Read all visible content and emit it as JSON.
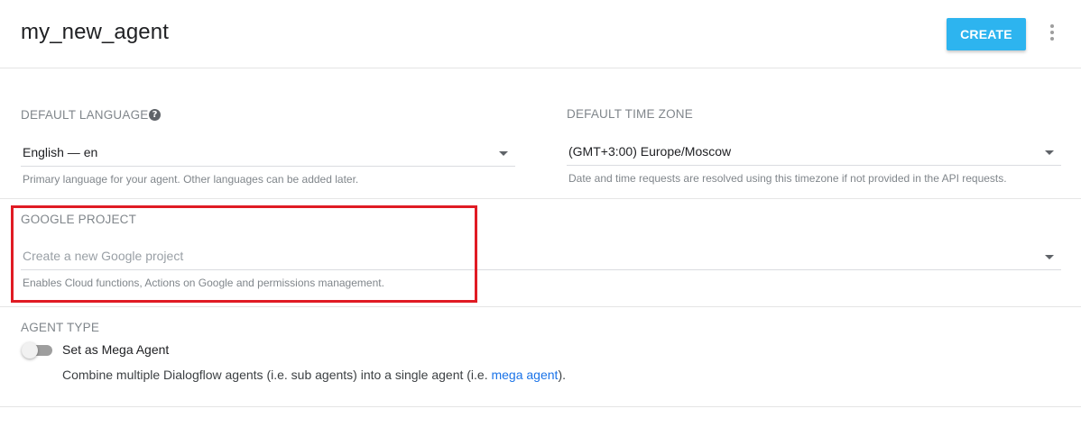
{
  "header": {
    "agent_name": "my_new_agent",
    "create_label": "CREATE"
  },
  "language": {
    "label": "DEFAULT LANGUAGE",
    "help_icon": "?",
    "value": "English — en",
    "hint": "Primary language for your agent. Other languages can be added later."
  },
  "timezone": {
    "label": "DEFAULT TIME ZONE",
    "value": "(GMT+3:00) Europe/Moscow",
    "hint": "Date and time requests are resolved using this timezone if not provided in the API requests."
  },
  "google_project": {
    "label": "GOOGLE PROJECT",
    "placeholder": "Create a new Google project",
    "hint": "Enables Cloud functions, Actions on Google and permissions management."
  },
  "agent_type": {
    "label": "AGENT TYPE",
    "toggle_label": "Set as Mega Agent",
    "toggle_on": false,
    "desc_prefix": "Combine multiple Dialogflow agents (i.e. sub agents) into a single agent (i.e. ",
    "desc_link": "mega agent",
    "desc_suffix": ")."
  },
  "colors": {
    "accent": "#2db4ef",
    "highlight": "#e01b24",
    "link": "#1a73e8"
  },
  "icons": {
    "more": "more-vert-icon",
    "help": "help-circle-icon",
    "dropdown": "arrow-drop-down-icon"
  }
}
